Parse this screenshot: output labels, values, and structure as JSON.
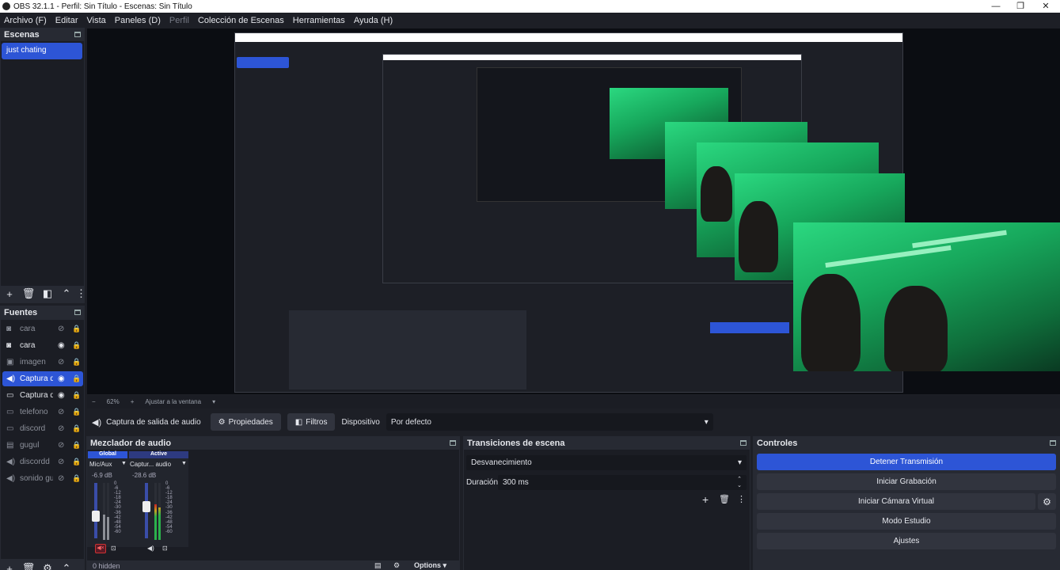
{
  "window": {
    "title": "OBS 32.1.1 - Perfil: Sin Título - Escenas: Sin Título",
    "minimize": "—",
    "maximize": "❐",
    "close": "✕"
  },
  "menu": [
    "Archivo (F)",
    "Editar",
    "Vista",
    "Paneles (D)",
    "Perfil",
    "Colección de Escenas",
    "Herramientas",
    "Ayuda (H)"
  ],
  "scenes": {
    "title": "Escenas",
    "items": [
      "just chating"
    ]
  },
  "sources": {
    "title": "Fuentes",
    "items": [
      {
        "label": "cara",
        "type": "camera-icon",
        "visible": false,
        "active": false
      },
      {
        "label": "cara",
        "type": "camera-icon",
        "visible": true,
        "active": false
      },
      {
        "label": "imagen",
        "type": "image-icon",
        "visible": false,
        "active": false
      },
      {
        "label": "Captura d",
        "type": "speaker-icon",
        "visible": true,
        "active": true
      },
      {
        "label": "Captura d",
        "type": "window-icon",
        "visible": true,
        "active": false
      },
      {
        "label": "telefono",
        "type": "window-icon",
        "visible": false,
        "active": false
      },
      {
        "label": "discord",
        "type": "window-icon",
        "visible": false,
        "active": false
      },
      {
        "label": "gugul",
        "type": "browser-icon",
        "visible": false,
        "active": false
      },
      {
        "label": "discordd",
        "type": "speaker-icon",
        "visible": false,
        "active": false
      },
      {
        "label": "sonido gu",
        "type": "speaker-icon",
        "visible": false,
        "active": false
      }
    ]
  },
  "zoom": {
    "minus": "−",
    "value": "62%",
    "plus": "+",
    "fit": "Ajustar a la ventana"
  },
  "context": {
    "source_name": "Captura de salida de audio",
    "properties": "Propiedades",
    "filters": "Filtros",
    "device_label": "Dispositivo",
    "device_value": "Por defecto"
  },
  "mixer": {
    "title": "Mezclador de audio",
    "channels": [
      {
        "head": "Global",
        "name": "Mic/Aux",
        "db": "-6.9 dB",
        "level": 0.45,
        "muted": true
      },
      {
        "head": "Active",
        "name": "Captur... audio",
        "db": "-28.6 dB",
        "level": 0.62,
        "muted": false
      }
    ],
    "scale": [
      "0",
      "-6",
      "-12",
      "-18",
      "-24",
      "-30",
      "-36",
      "-42",
      "-48",
      "-54",
      "-60"
    ],
    "hidden": "0 hidden",
    "options": "Options"
  },
  "transitions": {
    "title": "Transiciones de escena",
    "selected": "Desvanecimiento",
    "duration_label": "Duración",
    "duration_value": "300 ms"
  },
  "controls": {
    "title": "Controles",
    "stop_stream": "Detener Transmisión",
    "start_recording": "Iniciar Grabación",
    "start_virtualcam": "Iniciar Cámara Virtual",
    "studio_mode": "Modo Estudio",
    "settings": "Ajustes"
  },
  "colors": {
    "accent": "#2d55d6",
    "panel": "#272a33",
    "background": "#1d1f26"
  }
}
